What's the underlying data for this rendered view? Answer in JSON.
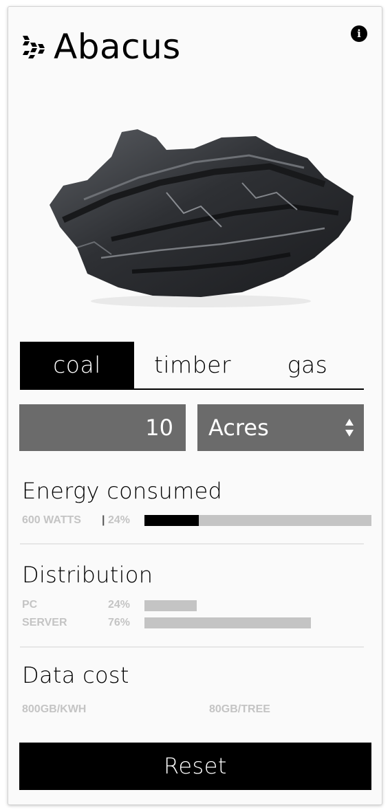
{
  "app": {
    "title": "Abacus"
  },
  "tabs": [
    {
      "label": "coal",
      "active": true
    },
    {
      "label": "timber",
      "active": false
    },
    {
      "label": "gas",
      "active": false
    }
  ],
  "input": {
    "quantity": "10",
    "unit": "Acres"
  },
  "energy": {
    "title": "Energy consumed",
    "watts_label": "600 WATTS",
    "separator": "|",
    "percent_label": "24%",
    "percent_value": 0.24
  },
  "distribution": {
    "title": "Distribution",
    "rows": [
      {
        "label": "PC",
        "percent_label": "24%",
        "value": 0.24
      },
      {
        "label": "SERVER",
        "percent_label": "76%",
        "value": 0.76
      }
    ]
  },
  "data_cost": {
    "title": "Data cost",
    "left": "800GB/KWH",
    "right": "80GB/TREE"
  },
  "reset_label": "Reset",
  "colors": {
    "accent": "#000000",
    "input_bg": "#6b6b6b",
    "bar_track": "#c4c4c4",
    "muted_text": "#c4c4c4",
    "card_bg": "#fafafa"
  },
  "icons": {
    "logo": "abacus-logo-icon",
    "info": "info-icon",
    "unit_arrows": "up-down-arrows-icon"
  }
}
